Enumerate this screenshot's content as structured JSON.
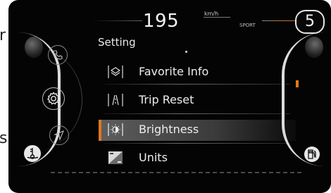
{
  "header": {
    "speed": "195",
    "speed_unit": "km/h",
    "drive_mode": "SPORT",
    "gear": "5"
  },
  "menu": {
    "title": "Setting",
    "items": [
      {
        "label": "Favorite Info",
        "icon": "layers-icon",
        "selected": false
      },
      {
        "label": "Trip Reset",
        "icon": "trip-reset-icon",
        "selected": false
      },
      {
        "label": "Brightness",
        "icon": "brightness-icon",
        "selected": true
      },
      {
        "label": "Units",
        "icon": "units-icon",
        "selected": false
      }
    ]
  },
  "left_icons": [
    "phone-icon",
    "settings-gear-icon",
    "navigation-arrow-icon",
    "coolant-temperature-icon"
  ],
  "right_icons": [
    "fuel-pump-icon"
  ],
  "colors": {
    "background": "#040404",
    "accent": "#e07820",
    "text": "#f2f2f2",
    "selection": "#5e5e5e"
  },
  "edge_text": {
    "left_top": "r",
    "left_bottom": "s"
  }
}
